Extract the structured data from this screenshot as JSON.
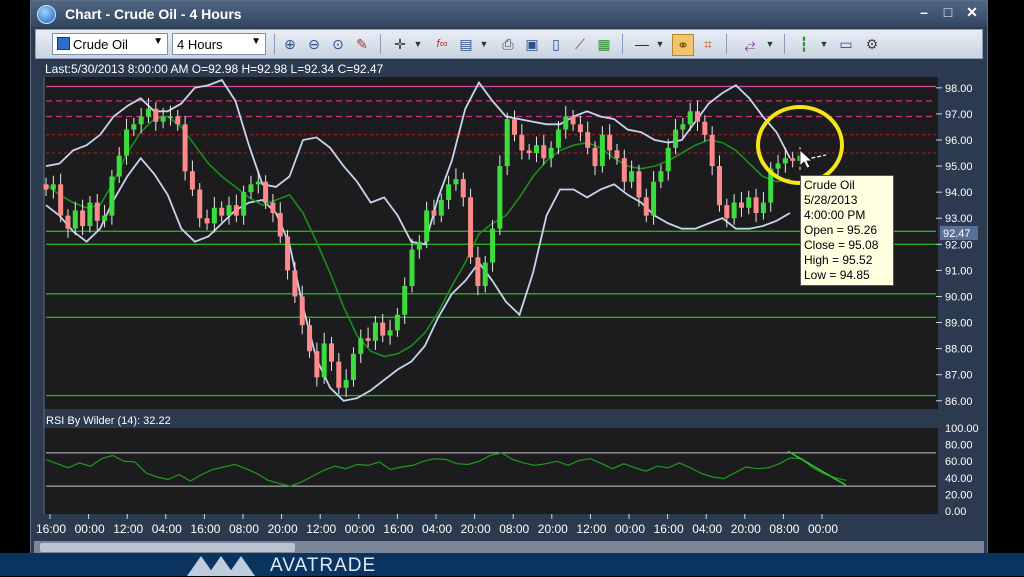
{
  "window": {
    "title": "Chart - Crude Oil - 4 Hours",
    "minimize": "–",
    "maximize": "□",
    "close": "✕"
  },
  "toolbar": {
    "symbol": "Crude Oil",
    "timeframe": "4 Hours",
    "icons": [
      "zoom-in-icon",
      "zoom-out-icon",
      "zoom-fit-icon",
      "draw-icon",
      "crosshair-icon",
      "function-icon",
      "template-icon",
      "print-icon",
      "save-icon",
      "document-icon",
      "chart-line-icon",
      "export-icon",
      "line-style-icon",
      "link-icon",
      "grid-icon",
      "indicator-icon",
      "candle-icon",
      "notes-icon",
      "settings-icon"
    ]
  },
  "info": {
    "last": "Last:5/30/2013 8:00:00 AM O=92.98 H=92.98 L=92.34 C=92.47"
  },
  "tooltip": {
    "symbol": "Crude Oil",
    "date": "5/28/2013",
    "time": "4:00:00 PM",
    "open": "Open = 95.26",
    "close": "Close = 95.08",
    "high": "High = 95.52",
    "low": "Low = 94.85"
  },
  "rsi": {
    "label": "RSI By Wilder (14): 32.22"
  },
  "price_badge": "92.47",
  "footer": {
    "brand": "AVATRADE"
  },
  "colors": {
    "bull": "#3ddc3d",
    "bear": "#ff8a8a",
    "bands": "#c7d4ee",
    "ma": "#1a8f1a",
    "highlight": "#f5e51b"
  },
  "chart_data": {
    "type": "candlestick",
    "y_axis": {
      "ticks": [
        "98.00",
        "97.00",
        "96.00",
        "95.00",
        "94.00",
        "93.00",
        "92.00",
        "91.00",
        "90.00",
        "89.00",
        "88.00",
        "87.00",
        "86.00"
      ],
      "ylim": [
        85.8,
        98.3
      ]
    },
    "x_axis": {
      "ticks": [
        "16:00",
        "00:00",
        "12:00",
        "04:00",
        "16:00",
        "08:00",
        "20:00",
        "12:00",
        "00:00",
        "16:00",
        "04:00",
        "20:00",
        "08:00",
        "20:00",
        "12:00",
        "00:00",
        "16:00",
        "04:00",
        "20:00",
        "08:00",
        "00:00"
      ]
    },
    "horizontal_lines": {
      "magenta": [
        97.5,
        96.9
      ],
      "red": [
        96.2,
        95.5
      ],
      "green": [
        92.5,
        92.0,
        90.1,
        89.2,
        86.2
      ]
    },
    "close_series": [
      94.1,
      94.3,
      93.1,
      92.6,
      93.3,
      92.7,
      93.6,
      92.9,
      93.1,
      94.6,
      95.4,
      96.4,
      96.6,
      96.9,
      97.2,
      96.7,
      96.9,
      96.9,
      96.6,
      94.8,
      94.1,
      93.0,
      92.8,
      93.4,
      93.1,
      93.5,
      93.1,
      94.0,
      94.3,
      94.4,
      93.6,
      93.2,
      92.3,
      91.0,
      90.0,
      88.9,
      87.9,
      86.9,
      88.2,
      87.5,
      86.5,
      86.8,
      87.8,
      88.4,
      88.3,
      89.0,
      88.5,
      88.7,
      89.3,
      90.4,
      91.8,
      92.1,
      93.3,
      93.1,
      93.7,
      94.3,
      94.5,
      93.8,
      91.5,
      90.4,
      91.3,
      92.6,
      95.0,
      96.8,
      96.2,
      95.6,
      95.5,
      95.8,
      95.3,
      95.7,
      96.4,
      96.9,
      96.6,
      96.3,
      95.7,
      95.0,
      96.2,
      95.6,
      95.3,
      94.4,
      94.8,
      93.8,
      93.1,
      94.4,
      94.8,
      95.7,
      96.4,
      96.6,
      97.1,
      96.7,
      96.2,
      95.0,
      93.5,
      93.0,
      93.6,
      93.4,
      93.8,
      93.2,
      93.6,
      94.9,
      95.1,
      95.3,
      95.2,
      95.4
    ],
    "upper_band": [
      95.0,
      95.1,
      95.6,
      95.8,
      96.2,
      96.9,
      97.3,
      97.6,
      97.1,
      97.1,
      97.4,
      98.0,
      98.1,
      98.3,
      97.5,
      95.8,
      94.3,
      94.2,
      94.6,
      96.0,
      96.1,
      95.7,
      95.0,
      94.4,
      93.6,
      93.8,
      93.1,
      92.1,
      92.0,
      93.8,
      95.2,
      97.2,
      98.2,
      97.5,
      96.9,
      96.8,
      96.7,
      96.6,
      96.6,
      96.9,
      97.1,
      96.9,
      96.8,
      96.4,
      96.3,
      96.0,
      95.9,
      96.0,
      96.7,
      97.4,
      97.8,
      98.1,
      97.6,
      96.9,
      96.3,
      95.3
    ],
    "lower_band": [
      93.5,
      93.1,
      92.5,
      92.1,
      92.6,
      93.7,
      94.6,
      95.3,
      94.7,
      93.9,
      92.6,
      92.1,
      92.3,
      92.8,
      93.3,
      93.6,
      93.7,
      93.2,
      92.0,
      89.6,
      87.6,
      86.5,
      86.0,
      86.1,
      86.4,
      86.8,
      87.2,
      87.5,
      88.1,
      89.2,
      90.1,
      90.6,
      91.3,
      90.6,
      89.8,
      89.3,
      90.9,
      93.1,
      94.1,
      94.1,
      93.8,
      94.1,
      94.3,
      93.9,
      93.6,
      93.1,
      92.8,
      92.6,
      92.6,
      92.8,
      93.0,
      92.6,
      92.6,
      92.7,
      92.9,
      93.2
    ],
    "moving_average": [
      94.3,
      93.9,
      93.6,
      93.4,
      93.5,
      94.4,
      95.5,
      96.3,
      96.8,
      96.9,
      96.5,
      95.8,
      95.1,
      94.6,
      94.2,
      93.8,
      93.5,
      93.7,
      93.9,
      93.2,
      92.1,
      90.9,
      89.6,
      88.5,
      87.9,
      87.7,
      87.8,
      88.1,
      88.6,
      89.4,
      90.4,
      91.3,
      92.4,
      92.8,
      93.1,
      93.8,
      94.6,
      95.2,
      95.6,
      95.8,
      95.9,
      95.7,
      95.3,
      95.0,
      94.9,
      95.0,
      95.2,
      95.5,
      95.8,
      96.0,
      95.9,
      95.6,
      95.1,
      94.6,
      94.4,
      94.5
    ],
    "rsi_axis": {
      "ticks": [
        "100.00",
        "80.00",
        "60.00",
        "40.00",
        "20.00",
        "0.00"
      ],
      "levels": [
        70,
        30
      ]
    },
    "rsi_series": [
      62,
      57,
      52,
      58,
      54,
      63,
      67,
      60,
      59,
      46,
      41,
      38,
      44,
      36,
      44,
      50,
      53,
      56,
      51,
      45,
      37,
      33,
      30,
      35,
      42,
      49,
      54,
      51,
      56,
      55,
      59,
      50,
      53,
      55,
      60,
      63,
      62,
      57,
      56,
      60,
      67,
      70,
      62,
      58,
      55,
      57,
      60,
      55,
      61,
      63,
      57,
      51,
      57,
      52,
      48,
      54,
      52,
      58,
      52,
      45,
      41,
      39,
      46,
      53,
      51,
      52,
      57,
      64,
      63,
      52,
      45,
      40,
      37
    ]
  }
}
